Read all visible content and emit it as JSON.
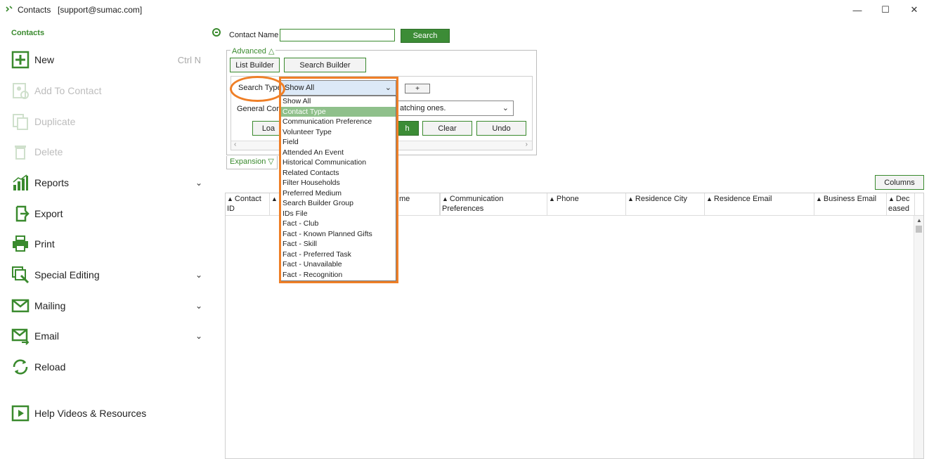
{
  "window": {
    "title": "Contacts",
    "user": "[support@sumac.com]",
    "minimize_glyph": "—",
    "maximize_glyph": "☐",
    "close_glyph": "✕"
  },
  "sidebar": {
    "heading": "Contacts",
    "items": [
      {
        "label": "New",
        "shortcut": "Ctrl N",
        "icon": "plus-box-icon",
        "enabled": true
      },
      {
        "label": "Add To Contact",
        "icon": "add-contact-icon",
        "enabled": false
      },
      {
        "label": "Duplicate",
        "icon": "duplicate-icon",
        "enabled": false
      },
      {
        "label": "Delete",
        "icon": "trash-icon",
        "enabled": false
      },
      {
        "label": "Reports",
        "icon": "bar-chart-icon",
        "enabled": true,
        "expandable": true
      },
      {
        "label": "Export",
        "icon": "export-icon",
        "enabled": true
      },
      {
        "label": "Print",
        "icon": "printer-icon",
        "enabled": true
      },
      {
        "label": "Special Editing",
        "icon": "special-editing-icon",
        "enabled": true,
        "expandable": true
      },
      {
        "label": "Mailing",
        "icon": "mail-icon",
        "enabled": true,
        "expandable": true
      },
      {
        "label": "Email",
        "icon": "email-icon",
        "enabled": true,
        "expandable": true
      },
      {
        "label": "Reload",
        "icon": "reload-icon",
        "enabled": true
      },
      {
        "label": "Help Videos & Resources",
        "icon": "video-icon",
        "enabled": true
      }
    ],
    "chevron_glyph": "⌄"
  },
  "search": {
    "contact_name_label": "Contact Name",
    "contact_name_value": "",
    "search_button": "Search"
  },
  "advanced": {
    "legend": "Advanced △",
    "list_builder": "List Builder",
    "search_builder": "Search Builder",
    "search_type_label": "Search Type:",
    "search_type_value": "Show All",
    "plus_button": "+",
    "general_label": "General Cont",
    "general_value": "atching ones.",
    "load_button": "Loa",
    "search_button_partial": "h",
    "clear_button": "Clear",
    "undo_button": "Undo",
    "scroll_left": "‹",
    "scroll_right": "›",
    "select_arrow": "⌄"
  },
  "expansion": {
    "label": "Expansion ▽"
  },
  "columns_button": "Columns",
  "grid": {
    "columns": [
      {
        "label": "Contact ID",
        "line1": "Contact",
        "line2": "ID"
      },
      {
        "label": "me"
      },
      {
        "label": "Communication Preferences"
      },
      {
        "label": "Phone"
      },
      {
        "label": "Residence City"
      },
      {
        "label": "Residence Email"
      },
      {
        "label": "Business Email"
      },
      {
        "label": "Deceased",
        "line1": "Dec",
        "line2": "eased"
      }
    ],
    "sort_glyph": "▲",
    "scroll_up": "▲"
  },
  "dropdown": {
    "selected_index": 1,
    "options": [
      "Show All",
      "Contact Type",
      "Communication Preference",
      "Volunteer Type",
      "Field",
      "Attended An Event",
      "Historical Communication",
      "Related Contacts",
      "Filter Households",
      "Preferred Medium",
      "Search Builder Group",
      "IDs File",
      "Fact - Club",
      "Fact - Known Planned Gifts",
      "Fact - Skill",
      "Fact - Preferred Task",
      "Fact - Unavailable",
      "Fact - Recognition"
    ]
  },
  "colors": {
    "brand_green": "#3c8c36",
    "highlight_orange": "#ef7f27",
    "selected_row": "#8fc08b"
  }
}
